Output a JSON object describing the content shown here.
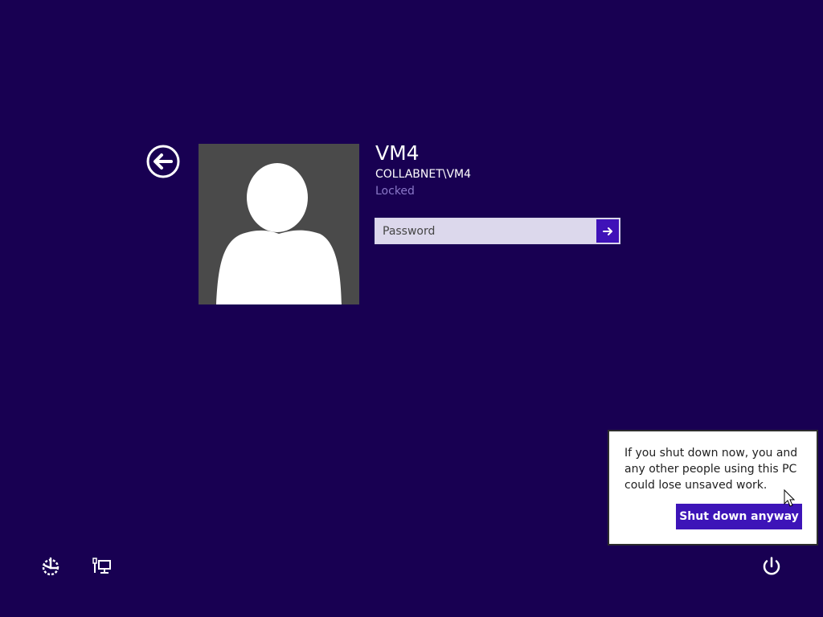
{
  "lock_screen": {
    "user": {
      "name": "VM4",
      "domain": "COLLABNET\\VM4",
      "status": "Locked"
    },
    "password": {
      "placeholder": "Password",
      "value": ""
    },
    "shutdown_flyout": {
      "message": "If you shut down now, you and any other people using this PC could lose unsaved work.",
      "button_label": "Shut down anyway"
    },
    "icons": {
      "back": "back-arrow-icon",
      "submit": "right-arrow-icon",
      "ease_of_access": "ease-of-access-icon",
      "network": "network-icon",
      "power": "power-icon",
      "cursor": "mouse-cursor-icon"
    }
  },
  "colors": {
    "background": "#180052",
    "avatar_background": "#4a4a4a",
    "input_background": "#dcd8ec",
    "accent": "#3d14b8",
    "muted_status": "#8a78c8",
    "flyout_border": "#2d2d2d"
  }
}
